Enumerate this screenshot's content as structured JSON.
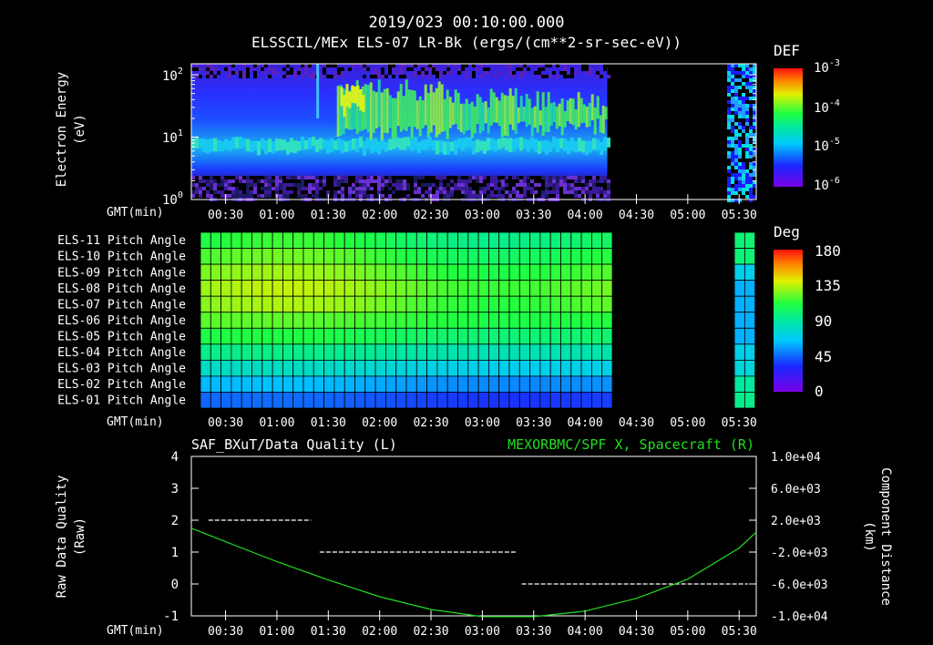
{
  "header": {
    "timestamp": "2019/023 00:10:00.000",
    "title": "ELSSCIL/MEx ELS-07 LR-Bk  (ergs/(cm**2-sr-sec-eV))"
  },
  "axis_common": {
    "gmt_label": "GMT(min)",
    "time_ticks": [
      "00:30",
      "01:00",
      "01:30",
      "02:00",
      "02:30",
      "03:00",
      "03:30",
      "04:00",
      "04:30",
      "05:00",
      "05:30"
    ]
  },
  "panel1": {
    "ylabel_line1": "Electron Energy",
    "ylabel_line2": "(eV)",
    "y_ticks": [
      {
        "base": "10",
        "exp": "2"
      },
      {
        "base": "10",
        "exp": "1"
      },
      {
        "base": "10",
        "exp": "0"
      }
    ],
    "colorbar_label": "DEF",
    "colorbar_ticks": [
      {
        "base": "10",
        "exp": "-3"
      },
      {
        "base": "10",
        "exp": "-4"
      },
      {
        "base": "10",
        "exp": "-5"
      },
      {
        "base": "10",
        "exp": "-6"
      }
    ]
  },
  "panel2": {
    "row_labels": [
      "ELS-11 Pitch Angle",
      "ELS-10 Pitch Angle",
      "ELS-09 Pitch Angle",
      "ELS-08 Pitch Angle",
      "ELS-07 Pitch Angle",
      "ELS-06 Pitch Angle",
      "ELS-05 Pitch Angle",
      "ELS-04 Pitch Angle",
      "ELS-03 Pitch Angle",
      "ELS-02 Pitch Angle",
      "ELS-01 Pitch Angle"
    ],
    "colorbar_label": "Deg",
    "colorbar_ticks": [
      "180",
      "135",
      "90",
      "45",
      "0"
    ]
  },
  "panel3": {
    "left_title": "SAF_BXuT/Data Quality (L)",
    "right_title": "MEXORBMC/SPF X, Spacecraft (R)",
    "right_title_color": "#22dd22",
    "ylabel_left_line1": "Raw Data Quality",
    "ylabel_left_line2": "(Raw)",
    "ylabel_right_line1": "Component Distance",
    "ylabel_right_line2": "(km)",
    "left_ticks": [
      "4",
      "3",
      "2",
      "1",
      "0",
      "-1"
    ],
    "right_ticks": [
      "1.0e+04",
      "6.0e+03",
      "2.0e+03",
      "-2.0e+03",
      "-6.0e+03",
      "-1.0e+04"
    ]
  },
  "chart_data": [
    {
      "type": "heatmap",
      "title": "ELSSCIL/MEx ELS-07 LR-Bk  (ergs/(cm**2-sr-sec-eV))",
      "ylabel": "Electron Energy (eV)",
      "yscale": "log",
      "ylim": [
        1,
        150
      ],
      "xlim": [
        "00:10",
        "05:40"
      ],
      "colorbar": {
        "label": "DEF",
        "scale": "log",
        "range": [
          1e-06,
          0.001
        ]
      },
      "data_gap": [
        "04:13",
        "05:23"
      ]
    },
    {
      "type": "heatmap",
      "rows": [
        "ELS-11",
        "ELS-10",
        "ELS-09",
        "ELS-08",
        "ELS-07",
        "ELS-06",
        "ELS-05",
        "ELS-04",
        "ELS-03",
        "ELS-02",
        "ELS-01"
      ],
      "pitch_angle_deg_early": [
        110,
        118,
        125,
        130,
        127,
        120,
        110,
        95,
        80,
        62,
        45
      ],
      "pitch_angle_deg_late": [
        100,
        100,
        70,
        60,
        60,
        60,
        60,
        70,
        75,
        90,
        95
      ],
      "colorbar": {
        "label": "Deg",
        "range": [
          0,
          180
        ]
      },
      "data_gap": [
        "04:13",
        "05:23"
      ]
    },
    {
      "type": "line",
      "x_units": "GMT",
      "series": [
        {
          "name": "SAF_BXuT/Data Quality (L)",
          "axis": "left",
          "style": "dashed",
          "segments": [
            {
              "x": [
                "00:20",
                "01:20"
              ],
              "y": 2
            },
            {
              "x": [
                "01:25",
                "03:20"
              ],
              "y": 1
            },
            {
              "x": [
                "03:23",
                "05:35"
              ],
              "y": 0
            }
          ]
        },
        {
          "name": "MEXORBMC/SPF X, Spacecraft (R)",
          "axis": "right",
          "x": [
            "00:10",
            "00:30",
            "01:00",
            "01:30",
            "02:00",
            "02:30",
            "03:00",
            "03:30",
            "04:00",
            "04:30",
            "05:00",
            "05:30",
            "05:40"
          ],
          "y": [
            1000,
            -700,
            -3200,
            -5500,
            -7600,
            -9200,
            -10100,
            -10100,
            -9400,
            -7800,
            -5400,
            -1500,
            500
          ]
        }
      ],
      "ylim_left": [
        -1,
        4
      ],
      "ylim_right": [
        -10000,
        10000
      ]
    }
  ]
}
